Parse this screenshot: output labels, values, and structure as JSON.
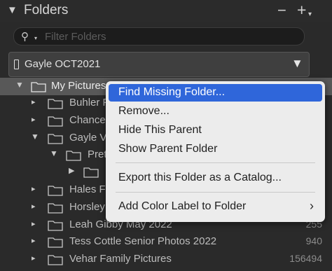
{
  "panel": {
    "title": "Folders",
    "collapse_icon": "triangle-down-icon",
    "minus": "−",
    "plus": "+"
  },
  "search": {
    "placeholder": "Filter Folders",
    "value": ""
  },
  "volume": {
    "name": "Gayle OCT2021"
  },
  "tree": {
    "root": {
      "label": "My Pictures"
    },
    "rows": [
      {
        "label": "Buhler Fa",
        "count": ""
      },
      {
        "label": "Chance S",
        "count": ""
      },
      {
        "label": "Gayle Ve",
        "count": ""
      },
      {
        "label": "Pret",
        "count": ""
      },
      {
        "label": "",
        "count": ""
      },
      {
        "label": "Hales Fa",
        "count": ""
      },
      {
        "label": "Horsley F",
        "count": ""
      },
      {
        "label": "Leah Gibby May 2022",
        "count": "255"
      },
      {
        "label": "Tess Cottle Senior Photos 2022",
        "count": "940"
      },
      {
        "label": "Vehar Family Pictures",
        "count": "156494"
      }
    ]
  },
  "context_menu": {
    "items": [
      {
        "label": "Find Missing Folder...",
        "highlighted": true
      },
      {
        "label": "Remove..."
      },
      {
        "label": "Hide This Parent"
      },
      {
        "label": "Show Parent Folder"
      },
      {
        "label": "Export this Folder as a Catalog..."
      },
      {
        "label": "Add Color Label to Folder",
        "submenu": true
      }
    ],
    "highlight_color": "#2f66da"
  }
}
